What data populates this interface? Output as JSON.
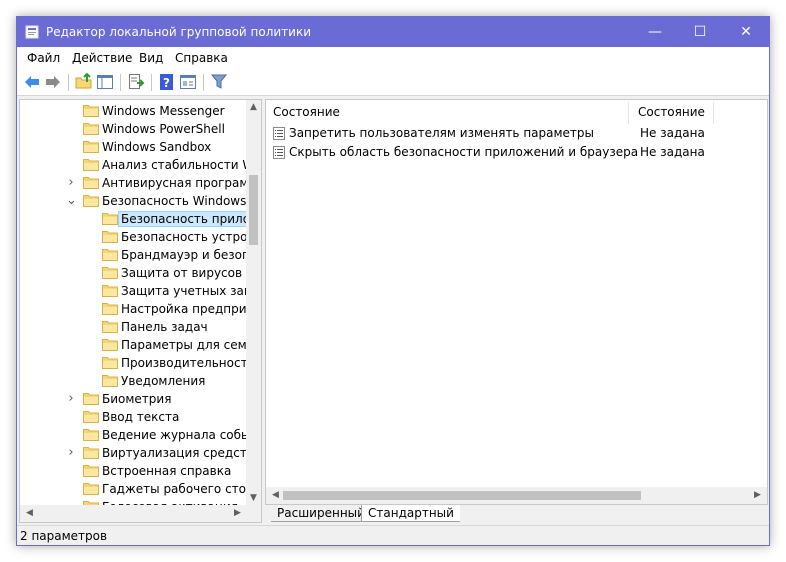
{
  "window": {
    "title": "Редактор локальной групповой политики",
    "controls": {
      "minimize": "—",
      "maximize": "☐",
      "close": "✕"
    }
  },
  "menu": [
    "Файл",
    "Действие",
    "Вид",
    "Справка"
  ],
  "toolbar": [
    "back-icon",
    "forward-icon",
    "up-folder-icon",
    "show-hide-tree-icon",
    "export-list-icon",
    "help-icon",
    "properties-icon",
    "filter-icon"
  ],
  "tree": [
    {
      "label": "Windows Messenger",
      "depth": 1,
      "expander": ""
    },
    {
      "label": "Windows PowerShell",
      "depth": 1,
      "expander": ""
    },
    {
      "label": "Windows Sandbox",
      "depth": 1,
      "expander": ""
    },
    {
      "label": "Анализ стабильности Windows",
      "depth": 1,
      "expander": ""
    },
    {
      "label": "Антивирусная программа",
      "depth": 1,
      "expander": ">"
    },
    {
      "label": "Безопасность Windows",
      "depth": 1,
      "expander": "v"
    },
    {
      "label": "Безопасность приложений и браузера",
      "depth": 2,
      "expander": "",
      "selected": true
    },
    {
      "label": "Безопасность устройства",
      "depth": 2,
      "expander": ""
    },
    {
      "label": "Брандмауэр и безопасность сети",
      "depth": 2,
      "expander": ""
    },
    {
      "label": "Защита от вирусов и угроз",
      "depth": 2,
      "expander": ""
    },
    {
      "label": "Защита учетных записей",
      "depth": 2,
      "expander": ""
    },
    {
      "label": "Настройка предприятия",
      "depth": 2,
      "expander": ""
    },
    {
      "label": "Панель задач",
      "depth": 2,
      "expander": ""
    },
    {
      "label": "Параметры для семьи",
      "depth": 2,
      "expander": ""
    },
    {
      "label": "Производительность и работоспособность",
      "depth": 2,
      "expander": ""
    },
    {
      "label": "Уведомления",
      "depth": 2,
      "expander": ""
    },
    {
      "label": "Биометрия",
      "depth": 1,
      "expander": ">"
    },
    {
      "label": "Ввод текста",
      "depth": 1,
      "expander": ""
    },
    {
      "label": "Ведение журнала событий",
      "depth": 1,
      "expander": ""
    },
    {
      "label": "Виртуализация средств",
      "depth": 1,
      "expander": ">"
    },
    {
      "label": "Встроенная справка",
      "depth": 1,
      "expander": ""
    },
    {
      "label": "Гаджеты рабочего стола",
      "depth": 1,
      "expander": ""
    },
    {
      "label": "Голосовая активация",
      "depth": 1,
      "expander": ""
    }
  ],
  "columns": {
    "name": "Состояние",
    "state": "Состояние"
  },
  "rows": [
    {
      "name": "Запретить пользователям изменять параметры",
      "state": "Не задана"
    },
    {
      "name": "Скрыть область безопасности приложений и браузера",
      "state": "Не задана"
    }
  ],
  "tabs": {
    "extended": "Расширенный",
    "standard": "Стандартный"
  },
  "status": {
    "text": "2 параметров"
  },
  "colors": {
    "titlebar": "#6b6bd6",
    "selection": "#cce8ff",
    "folder": "#f7d774"
  }
}
